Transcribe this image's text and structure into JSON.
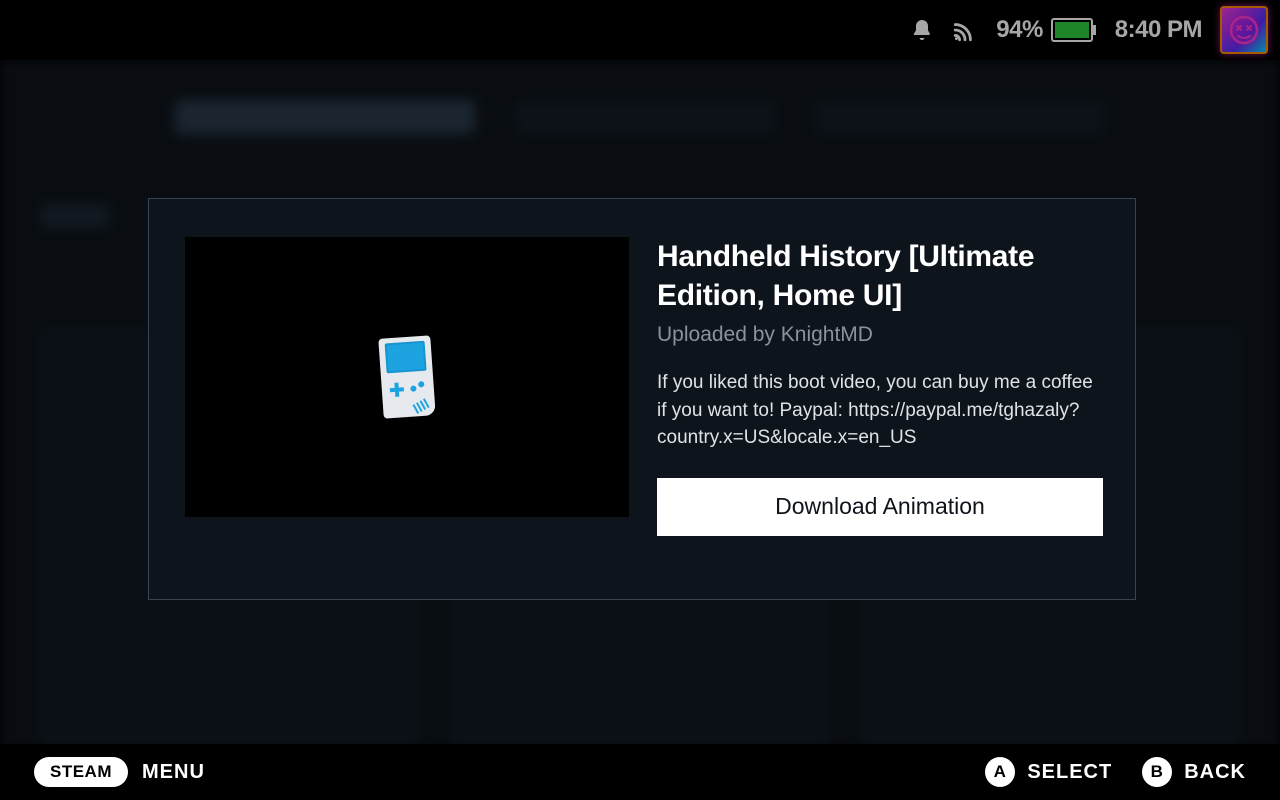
{
  "status": {
    "battery_percent": "94%",
    "clock": "8:40 PM"
  },
  "modal": {
    "title": "Handheld History [Ultimate Edition, Home UI]",
    "uploader_prefix": "Uploaded by ",
    "uploader_name": "KnightMD",
    "description": "If you liked this boot video, you can buy me a coffee if you want to! Paypal: https://paypal.me/tghazaly?country.x=US&locale.x=en_US",
    "download_label": "Download Animation"
  },
  "footer": {
    "steam": "STEAM",
    "menu": "MENU",
    "hint_a_key": "A",
    "hint_a_label": "SELECT",
    "hint_b_key": "B",
    "hint_b_label": "BACK"
  }
}
